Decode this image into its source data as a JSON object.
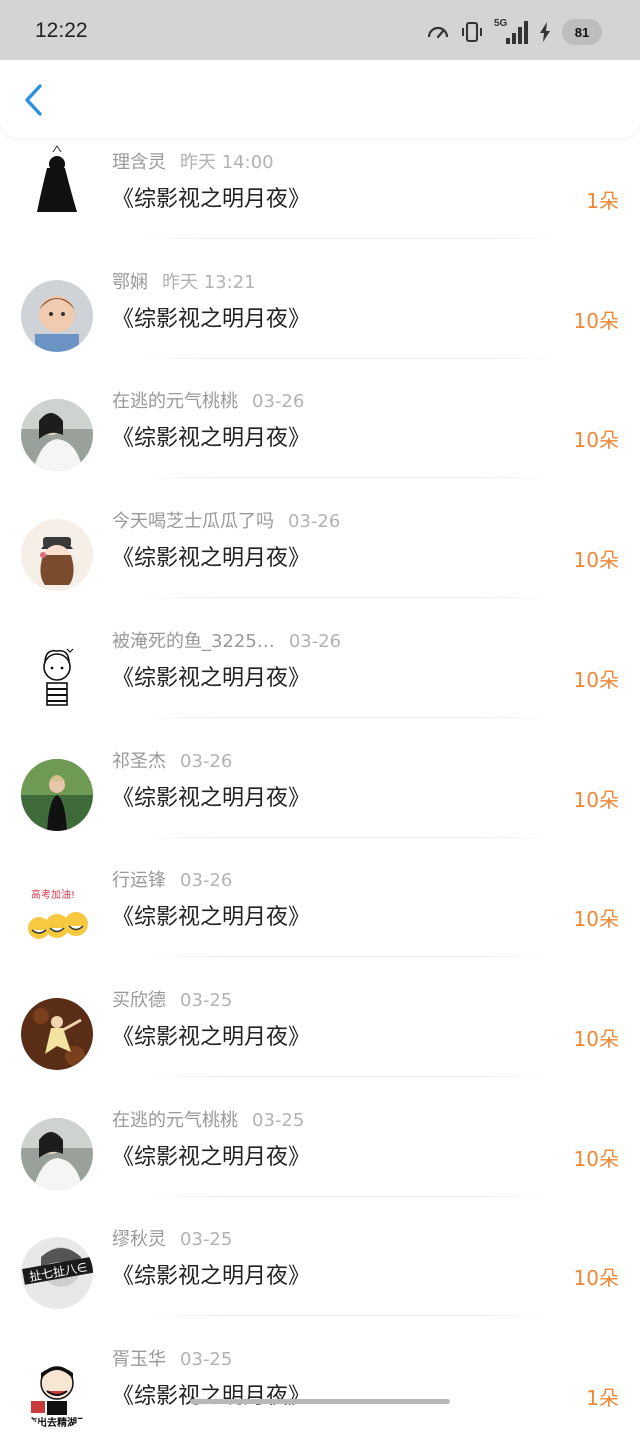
{
  "status_bar": {
    "time": "12:22",
    "network": "5G",
    "battery": "81"
  },
  "header": {
    "back_icon": "chevron-left-icon",
    "accent_color": "#2b8fe3"
  },
  "colors": {
    "count": "#ee8836",
    "name": "#999999",
    "title": "#222222"
  },
  "records": [
    {
      "name": "理含灵",
      "time": "昨天 14:00",
      "title": "《综影视之明月夜》",
      "count": "1朵",
      "avatar": "black-haired-girl-illustration"
    },
    {
      "name": "鄂娴",
      "time": "昨天 13:21",
      "title": "《综影视之明月夜》",
      "count": "10朵",
      "avatar": "baby-photo"
    },
    {
      "name": "在逃的元气桃桃",
      "time": "03-26",
      "title": "《综影视之明月夜》",
      "count": "10朵",
      "avatar": "girl-in-white-photo"
    },
    {
      "name": "今天喝芝士瓜瓜了吗",
      "time": "03-26",
      "title": "《综影视之明月夜》",
      "count": "10朵",
      "avatar": "cartoon-girl-hat"
    },
    {
      "name": "被淹死的鱼_3225…",
      "time": "03-26",
      "title": "《综影视之明月夜》",
      "count": "10朵",
      "avatar": "line-drawing-girl"
    },
    {
      "name": "祁圣杰",
      "time": "03-26",
      "title": "《综影视之明月夜》",
      "count": "10朵",
      "avatar": "girl-in-trees-photo"
    },
    {
      "name": "行运锋",
      "time": "03-26",
      "title": "《综影视之明月夜》",
      "count": "10朵",
      "avatar": "emoji-faces-sticker",
      "avatar_text": "高考加油!"
    },
    {
      "name": "买欣德",
      "time": "03-25",
      "title": "《综影视之明月夜》",
      "count": "10朵",
      "avatar": "dancer-on-leaves-photo"
    },
    {
      "name": "在逃的元气桃桃",
      "time": "03-25",
      "title": "《综影视之明月夜》",
      "count": "10朵",
      "avatar": "girl-in-white-photo"
    },
    {
      "name": "缪秋灵",
      "time": "03-25",
      "title": "《综影视之明月夜》",
      "count": "10朵",
      "avatar": "bw-face-sticker",
      "avatar_text": "扯七扯八∈"
    },
    {
      "name": "胥玉华",
      "time": "03-25",
      "title": "《综影视之明月夜》",
      "count": "1朵",
      "avatar": "meme-cartoon-sticker",
      "avatar_text": "拖出去精湖了"
    }
  ]
}
